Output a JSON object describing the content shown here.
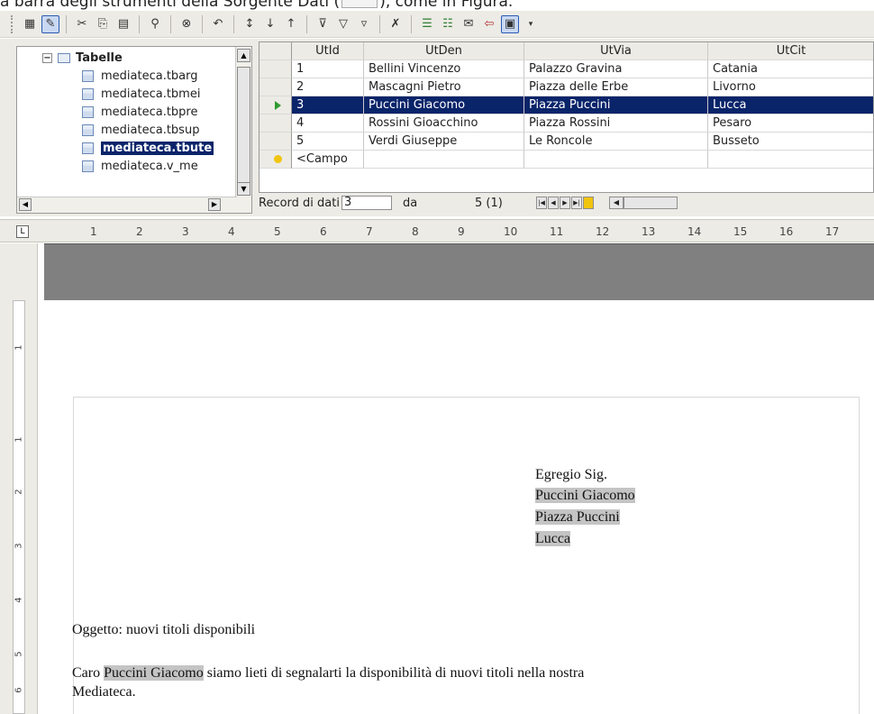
{
  "caption": {
    "before": "a barra degli strumenti della Sorgente Dati (",
    "after": "), come in Figura."
  },
  "toolbar": {
    "icons": [
      "save-icon",
      "edit-icon",
      "cut-icon",
      "copy-icon",
      "paste-icon",
      "find-icon",
      "binoculars-icon",
      "undo-icon",
      "sort-asc-icon",
      "sort-az-icon",
      "sort-za-icon",
      "autofilter-icon",
      "filter-icon",
      "standard-filter-icon",
      "remove-filter-icon",
      "data-to-text-icon",
      "data-to-fields-icon",
      "mail-merge-icon",
      "data-source-icon",
      "explorer-icon"
    ]
  },
  "tree": {
    "root_label": "Tabelle",
    "items": [
      "mediateca.tbarg",
      "mediateca.tbmei",
      "mediateca.tbpre",
      "mediateca.tbsup",
      "mediateca.tbute",
      "mediateca.v_me"
    ],
    "selected_index": 4
  },
  "grid": {
    "columns": [
      "UtId",
      "UtDen",
      "UtVia",
      "UtCit"
    ],
    "rows": [
      [
        "1",
        "Bellini Vincenzo",
        "Palazzo Gravina",
        "Catania"
      ],
      [
        "2",
        "Mascagni Pietro",
        "Piazza delle Erbe",
        "Livorno"
      ],
      [
        "3",
        "Puccini Giacomo",
        "Piazza Puccini",
        "Lucca"
      ],
      [
        "4",
        "Rossini Gioacchino",
        "Piazza Rossini",
        "Pesaro"
      ],
      [
        "5",
        "Verdi Giuseppe",
        "Le Roncole",
        "Busseto"
      ]
    ],
    "current_row": 2,
    "new_row_label": "<Campo"
  },
  "record_bar": {
    "label": "Record di dati",
    "current": "3",
    "da_label": "da",
    "total": "5 (1)"
  },
  "ruler": {
    "numbers": [
      "1",
      "2",
      "3",
      "4",
      "5",
      "6",
      "7",
      "8",
      "9",
      "10",
      "11",
      "12",
      "13",
      "14",
      "15",
      "16",
      "17"
    ]
  },
  "vruler": {
    "numbers": [
      "1",
      "1",
      "2",
      "3",
      "4",
      "5",
      "6"
    ]
  },
  "letter": {
    "salutation": "Egregio Sig.",
    "name": "Puccini Giacomo",
    "street": "Piazza Puccini",
    "city": "Lucca",
    "subject": "Oggetto: nuovi titoli disponibili",
    "body_prefix": "Caro ",
    "body_name": "Puccini Giacomo",
    "body_line1_rest": " siamo lieti di segnalarti la disponibilità di nuovi titoli nella nostra",
    "body_line2": "Mediateca."
  },
  "colors": {
    "selection": "#0a246a",
    "field_highlight": "#c4c4c4",
    "toolbar_bg": "#ecebe5",
    "gray_band": "#808080"
  }
}
